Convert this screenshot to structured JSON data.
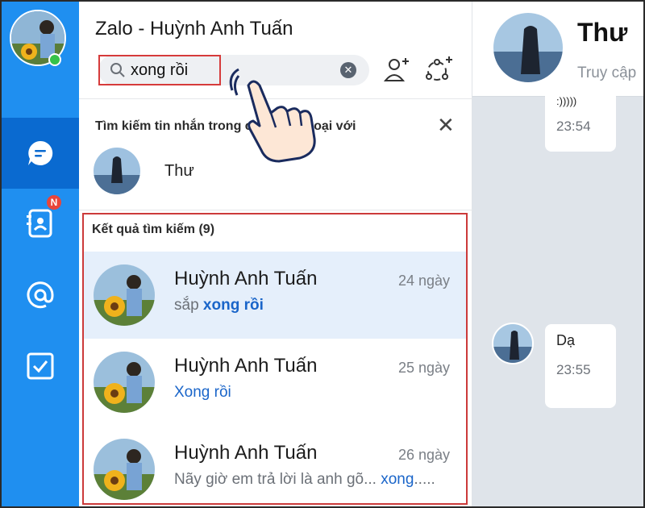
{
  "app": {
    "title": "Zalo - Huỳnh Anh Tuấn"
  },
  "search": {
    "value": "xong rồi",
    "placeholder": ""
  },
  "recent": {
    "header": "Tìm kiếm tin nhắn trong cuộc hội thoại với",
    "contact_name": "Thư"
  },
  "results": {
    "header": "Kết quả tìm kiếm (9)",
    "items": [
      {
        "name": "Huỳnh Anh Tuấn",
        "time": "24 ngày",
        "snippet_prefix": "sắp ",
        "snippet_match": "xong rồi",
        "snippet_suffix": ""
      },
      {
        "name": "Huỳnh Anh Tuấn",
        "time": "25 ngày",
        "snippet_prefix": "",
        "snippet_match": "Xong rồi",
        "snippet_suffix": ""
      },
      {
        "name": "Huỳnh Anh Tuấn",
        "time": "26 ngày",
        "snippet_prefix": "Nãy giờ em trả lời là anh gõ... ",
        "snippet_match": "xong",
        "snippet_suffix": "....."
      }
    ]
  },
  "chat": {
    "name": "Thư",
    "status": "Truy cập",
    "messages": [
      {
        "text": ":)))))",
        "time": "23:54"
      },
      {
        "text": "Dạ",
        "time": "23:55"
      }
    ]
  },
  "sidebar": {
    "badge": "N"
  },
  "colors": {
    "rail": "#1f8ff0",
    "rail_active": "#0a6ad0",
    "highlight": "#1a65c9",
    "annotation_red": "#d63b3b"
  }
}
